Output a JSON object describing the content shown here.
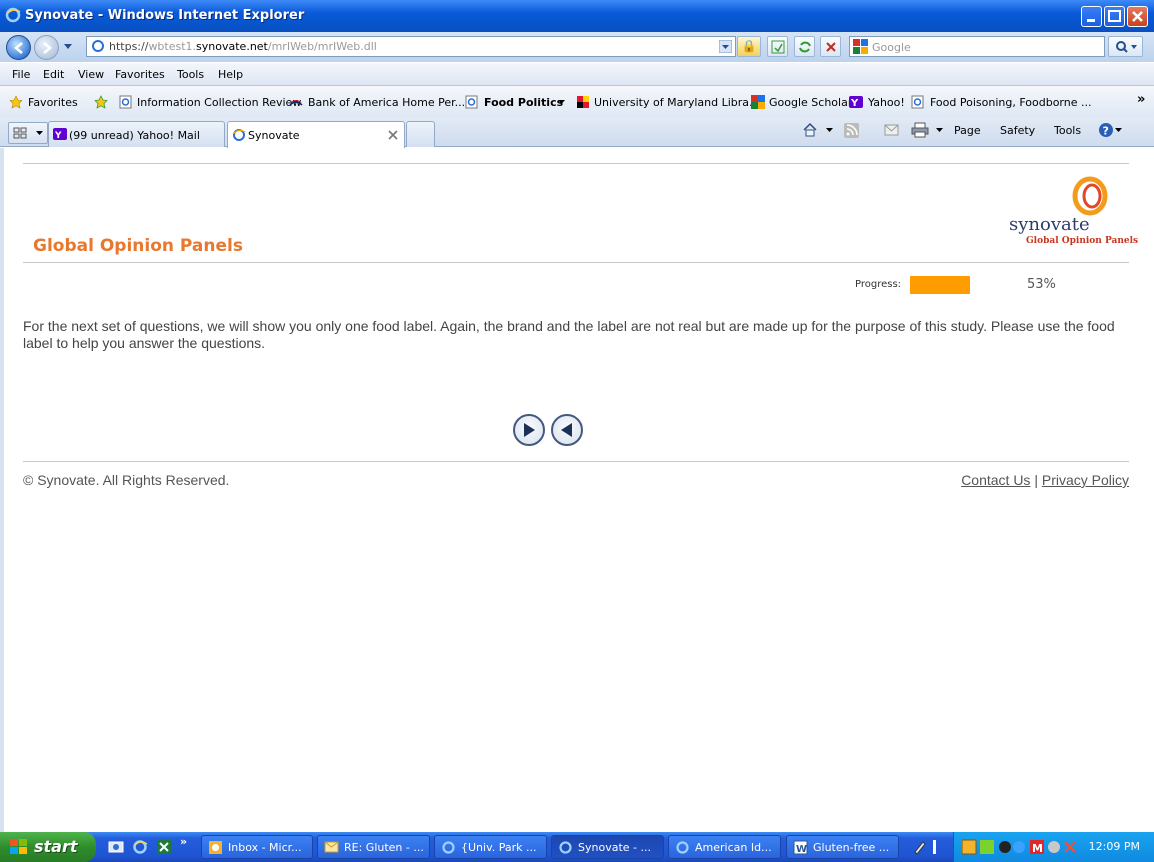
{
  "window": {
    "title": "Synovate - Windows Internet Explorer"
  },
  "address": {
    "scheme": "https://",
    "host_dim": "wbtest1.",
    "host": "synovate.net",
    "path": "/mrIWeb/mrIWeb.dll"
  },
  "search": {
    "placeholder": "Google"
  },
  "menu": [
    "File",
    "Edit",
    "View",
    "Favorites",
    "Tools",
    "Help"
  ],
  "favorites": {
    "label": "Favorites",
    "items": [
      "Information Collection Review",
      "Bank of America  Home  Per...",
      "Food Politics",
      "University of Maryland Libra...",
      "Google Scholar",
      "Yahoo!",
      "Food Poisoning, Foodborne ..."
    ]
  },
  "tabs": [
    "(99 unread) Yahoo! Mail",
    "Synovate"
  ],
  "commands": [
    "Page",
    "Safety",
    "Tools"
  ],
  "page": {
    "site_title": "Global Opinion Panels",
    "logo_word": "synovate",
    "logo_sub": "Global Opinion Panels",
    "progress_label": "Progress:",
    "progress_percent": 53,
    "progress_text": "53%",
    "instructions": "For the next set of questions, we will show you only one food label. Again, the brand and the label are not real but are made up for the purpose of this study. Please use the food label to help you answer the questions.",
    "copyright": "© Synovate. All Rights Reserved.",
    "contact": "Contact Us",
    "separator": "|",
    "privacy": "Privacy Policy"
  },
  "taskbar": {
    "start": "start",
    "items": [
      "Inbox - Micr...",
      "RE: Gluten - ...",
      "{Univ. Park ...",
      "Synovate - ...",
      "American Id...",
      "Gluten-free ..."
    ],
    "clock": "12:09 PM"
  },
  "colors": {
    "accent_orange": "#e8782e",
    "progress_orange": "#ff9d00",
    "xp_blue": "#245edb"
  }
}
